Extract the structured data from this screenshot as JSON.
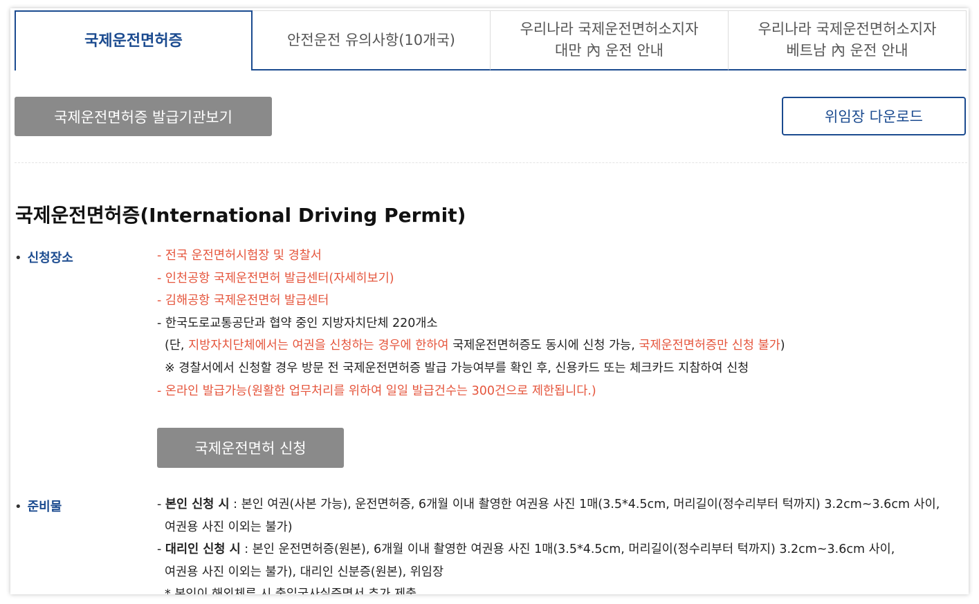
{
  "tabs": [
    {
      "line1": "국제운전면허증",
      "line2": "",
      "active": true
    },
    {
      "line1": "안전운전 유의사항(10개국)",
      "line2": "",
      "active": false
    },
    {
      "line1": "우리나라 국제운전면허소지자",
      "line2": "대만 內 운전 안내",
      "active": false
    },
    {
      "line1": "우리나라 국제운전면허소지자",
      "line2": "베트남 內 운전 안내",
      "active": false
    }
  ],
  "buttons": {
    "issuer": "국제운전면허증 발급기관보기",
    "download": "위임장 다운로드",
    "apply": "국제운전면허 신청"
  },
  "section": {
    "title": "국제운전면허증(International Driving Permit)"
  },
  "place": {
    "bullet": "•",
    "label": "신청장소",
    "line1": "- 전국 운전면허시험장 및 경찰서",
    "line2": "- 인천공항 국제운전면허 발급센터(자세히보기)",
    "line3": "- 김해공항 국제운전면허 발급센터",
    "line4": "- 한국도로교통공단과 협약 중인 지방자치단체 220개소",
    "line5_a": "(단, ",
    "line5_b": "지방자치단체에서는 여권을 신청하는 경우에 한하여",
    "line5_c": " 국제운전면허증도 동시에 신청 가능, ",
    "line5_d": "국제운전면허증만 신청 불가",
    "line5_e": ")",
    "line6": "※ 경찰서에서 신청할 경우 방문 전 국제운전면허증 발급 가능여부를 확인 후, 신용카드 또는 체크카드 지참하여 신청",
    "line7": "- 온라인 발급가능(원활한 업무처리를 위하여 일일 발급건수는 300건으로 제한됩니다.)"
  },
  "prep": {
    "bullet": "•",
    "label": "준비물",
    "self_prefix": "- ",
    "self_bold": "본인 신청 시",
    "self_text": " : 본인 여권(사본 가능), 운전면허증, 6개월 이내 촬영한 여권용 사진 1매(3.5*4.5cm, 머리길이(정수리부터 턱까지) 3.2cm~3.6cm 사이,",
    "self_text2": "여권용 사진 이외는 불가)",
    "proxy_prefix": "- ",
    "proxy_bold": "대리인 신청 시",
    "proxy_text": " : 본인 운전면허증(원본), 6개월 이내 촬영한 여권용 사진 1매(3.5*4.5cm, 머리길이(정수리부터 턱까지) 3.2cm~3.6cm 사이,",
    "proxy_text2": "여권용 사진 이외는 불가), 대리인 신분증(원본), 위임장",
    "note_partial": "* 본인이 해외체류 시 출입국사실증명서 추가 제출"
  },
  "colors": {
    "primary": "#1a4a8f",
    "accent_red": "#e5553c",
    "button_gray": "#8a8a8a"
  }
}
